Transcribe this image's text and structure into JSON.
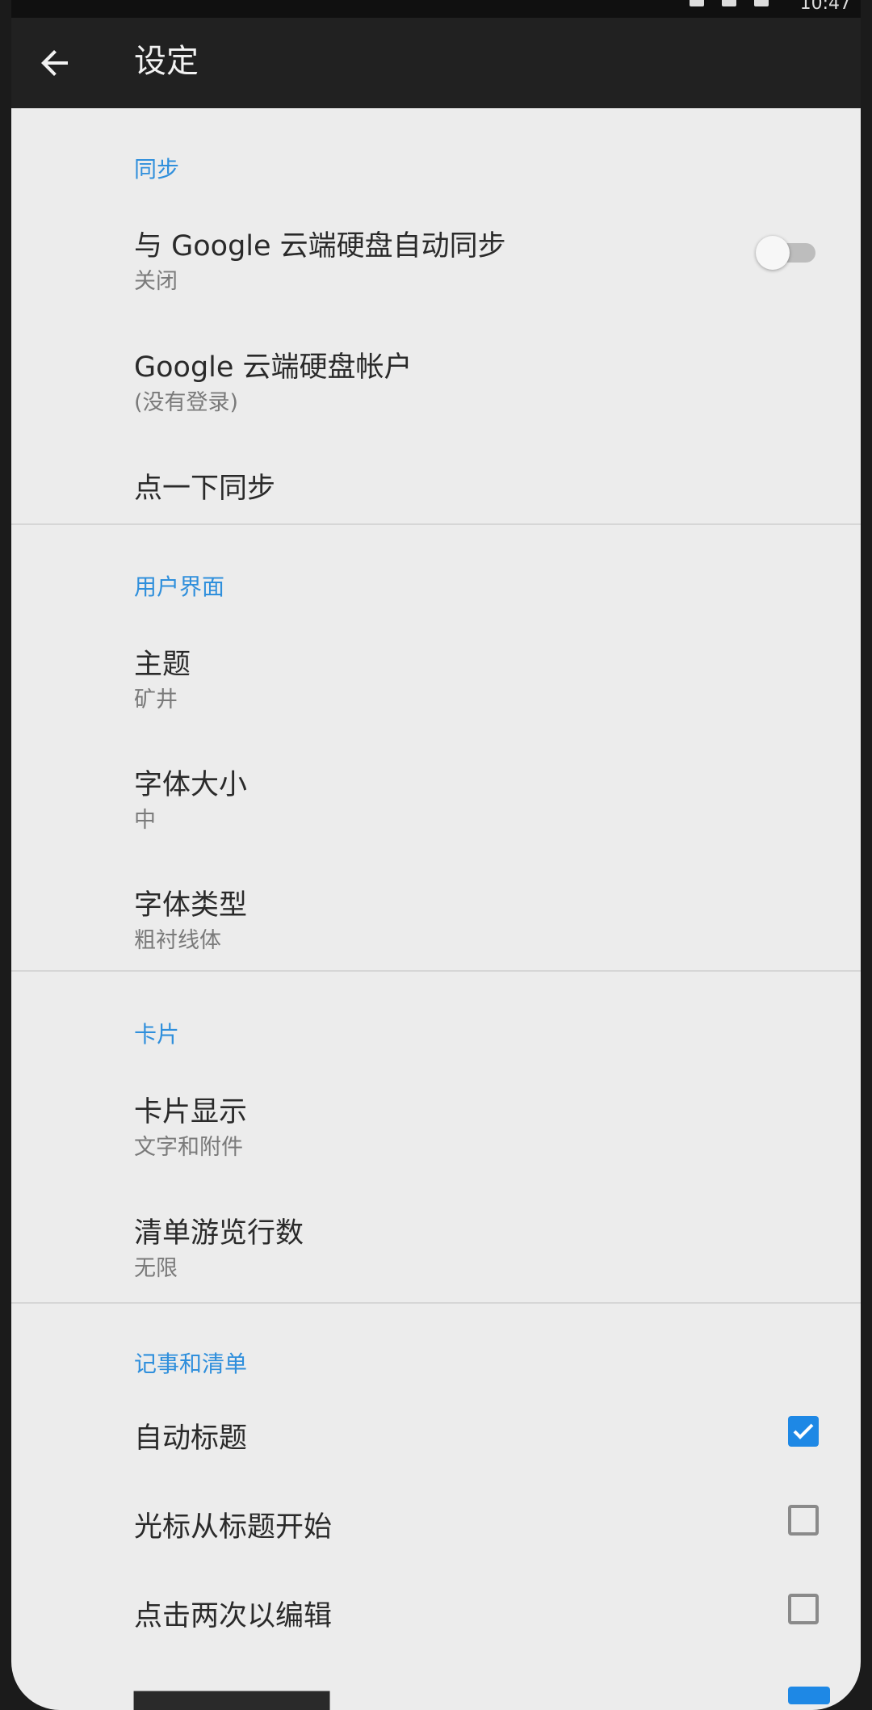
{
  "status_bar": {
    "time": "10:47"
  },
  "app_bar": {
    "title": "设定"
  },
  "sections": {
    "sync": {
      "header": "同步",
      "auto_sync": {
        "title": "与 Google 云端硬盘自动同步",
        "subtitle": "关闭",
        "toggle_on": false
      },
      "account": {
        "title": "Google 云端硬盘帐户",
        "subtitle": "(没有登录)"
      },
      "tap_sync": {
        "title": "点一下同步"
      }
    },
    "ui": {
      "header": "用户界面",
      "theme": {
        "title": "主题",
        "subtitle": "矿井"
      },
      "font_size": {
        "title": "字体大小",
        "subtitle": "中"
      },
      "font_type": {
        "title": "字体类型",
        "subtitle": "粗衬线体"
      }
    },
    "cards": {
      "header": "卡片",
      "card_display": {
        "title": "卡片显示",
        "subtitle": "文字和附件"
      },
      "list_preview": {
        "title": "清单游览行数",
        "subtitle": "无限"
      }
    },
    "notes": {
      "header": "记事和清单",
      "auto_title": {
        "title": "自动标题",
        "checked": true
      },
      "cursor_title": {
        "title": "光标从标题开始",
        "checked": false
      },
      "double_tap": {
        "title": "点击两次以编辑",
        "checked": false
      }
    }
  },
  "colors": {
    "accent": "#2f8fdc",
    "checkbox": "#1e88e5",
    "appbar": "#212121"
  },
  "icons": {
    "back": "arrow-left-icon"
  }
}
